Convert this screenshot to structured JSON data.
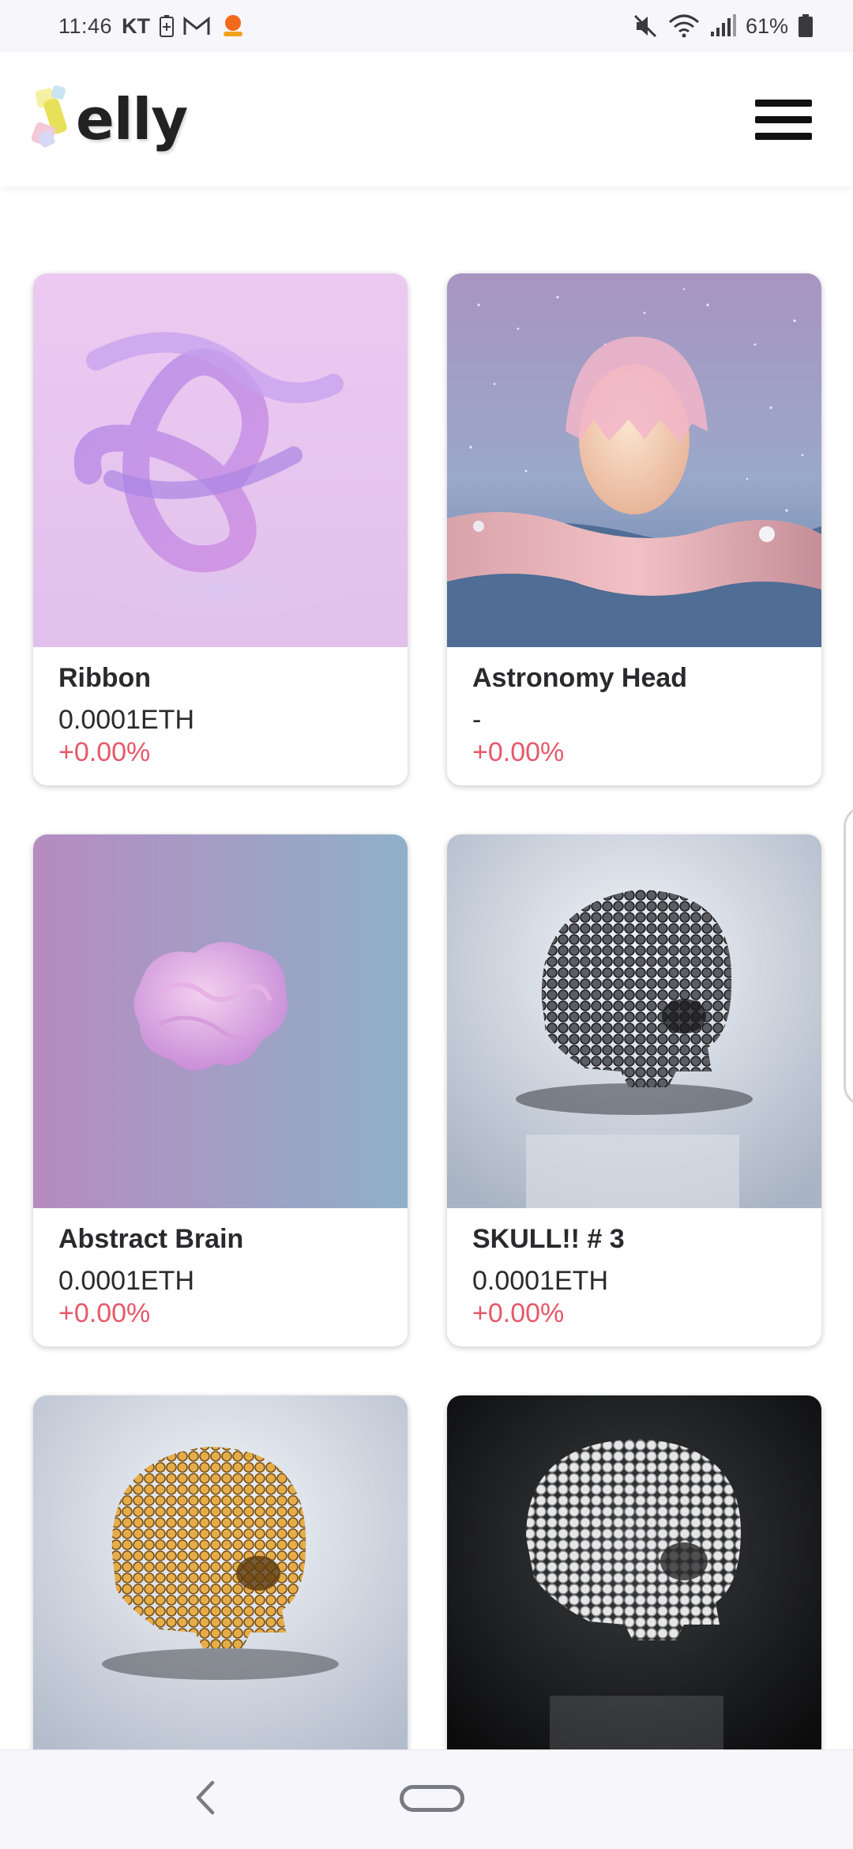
{
  "status_bar": {
    "time": "11:46",
    "carrier": "KT",
    "battery": "61%",
    "icons": [
      "battery-saver-icon",
      "gmail-icon",
      "app-notification-icon",
      "mute-icon",
      "wifi-icon",
      "signal-icon",
      "battery-icon"
    ]
  },
  "header": {
    "logo_text": "elly",
    "menu_icon": "hamburger-menu-icon"
  },
  "cards": [
    {
      "title": "Ribbon",
      "price": "0.0001ETH",
      "change": "+0.00%"
    },
    {
      "title": "Astronomy Head",
      "price": "-",
      "change": "+0.00%"
    },
    {
      "title": "Abstract Brain",
      "price": "0.0001ETH",
      "change": "+0.00%"
    },
    {
      "title": "SKULL!! # 3",
      "price": "0.0001ETH",
      "change": "+0.00%"
    },
    {
      "title": "",
      "price": "",
      "change": ""
    },
    {
      "title": "",
      "price": "",
      "change": ""
    }
  ],
  "nav": {
    "back_icon": "back-chevron-icon",
    "home_icon": "home-pill-icon"
  },
  "colors": {
    "accent_change": "#e5596a",
    "background": "#ffffff",
    "system_bar": "#f7f6fb"
  }
}
